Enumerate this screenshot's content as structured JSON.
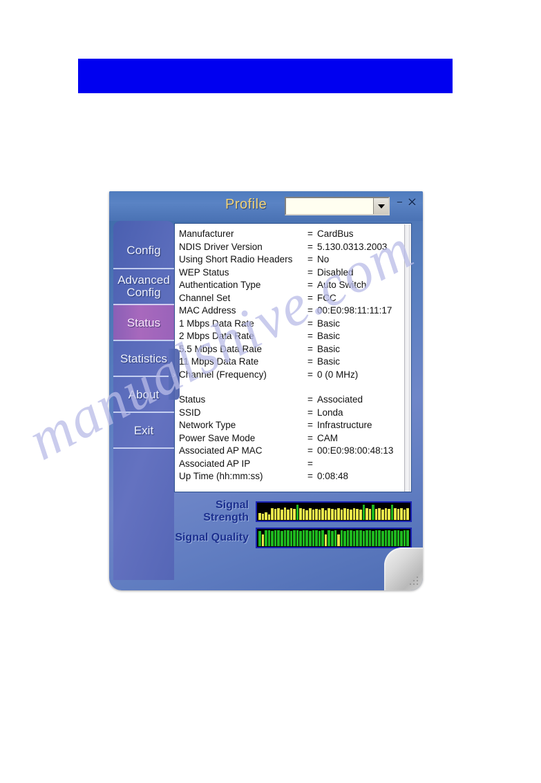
{
  "page": {
    "watermark_text": "manualshive.com",
    "banner_color": "#0000f0"
  },
  "window": {
    "titlebar": {
      "profile_label": "Profile",
      "profile_value": "",
      "profile_placeholder": "",
      "minimize_glyph": "–",
      "close_glyph": "×",
      "dropdown_arrow_icon": "chevron-down-icon"
    },
    "sidebar": {
      "collapse_glyph": "›",
      "items": [
        {
          "label": "Config",
          "active": false
        },
        {
          "label": "Advanced Config",
          "active": false
        },
        {
          "label": "Status",
          "active": true
        },
        {
          "label": "Statistics",
          "active": false
        },
        {
          "label": "About",
          "active": false
        },
        {
          "label": "Exit",
          "active": false
        }
      ]
    },
    "status_panel": {
      "rows": [
        {
          "key": "Manufacturer",
          "eq": "=",
          "value": "CardBus"
        },
        {
          "key": "NDIS Driver Version",
          "eq": "=",
          "value": "5.130.0313.2003"
        },
        {
          "key": "Using Short Radio Headers",
          "eq": "=",
          "value": "No"
        },
        {
          "key": "WEP Status",
          "eq": "=",
          "value": "Disabled"
        },
        {
          "key": "Authentication Type",
          "eq": "=",
          "value": "Auto Switch"
        },
        {
          "key": "Channel Set",
          "eq": "=",
          "value": "FCC"
        },
        {
          "key": "MAC Address",
          "eq": "=",
          "value": "00:E0:98:11:11:17"
        },
        {
          "key": "1 Mbps Data Rate",
          "eq": "=",
          "value": "Basic"
        },
        {
          "key": "2 Mbps Data Rate",
          "eq": "=",
          "value": "Basic"
        },
        {
          "key": "5.5 Mbps Data Rate",
          "eq": "=",
          "value": "Basic"
        },
        {
          "key": "11 Mbps Data Rate",
          "eq": "=",
          "value": "Basic"
        },
        {
          "key": "Channel (Frequency)",
          "eq": "=",
          "value": "0 (0 MHz)"
        },
        {
          "key": "",
          "eq": "",
          "value": ""
        },
        {
          "key": "Status",
          "eq": "=",
          "value": "Associated"
        },
        {
          "key": "SSID",
          "eq": "=",
          "value": "Londa"
        },
        {
          "key": "Network Type",
          "eq": "=",
          "value": "Infrastructure"
        },
        {
          "key": "Power Save Mode",
          "eq": "=",
          "value": "CAM"
        },
        {
          "key": "Associated AP MAC",
          "eq": "=",
          "value": "00:E0:98:00:48:13"
        },
        {
          "key": "Associated AP IP",
          "eq": "=",
          "value": ""
        },
        {
          "key": "Up Time (hh:mm:ss)",
          "eq": "=",
          "value": "0:08:48"
        }
      ]
    },
    "signal": {
      "strength": {
        "label": "Signal Strength",
        "bar_color_low": "#e9e84b",
        "bar_color_high": "#1fb81f",
        "levels": [
          42,
          38,
          46,
          34,
          70,
          66,
          72,
          64,
          74,
          62,
          70,
          66,
          92,
          72,
          66,
          58,
          70,
          62,
          68,
          64,
          72,
          60,
          70,
          66,
          62,
          70,
          64,
          72,
          66,
          62,
          70,
          68,
          64,
          90,
          72,
          68,
          92,
          66,
          70,
          64,
          72,
          66,
          92,
          70,
          66,
          72,
          64,
          70
        ]
      },
      "quality": {
        "label": "Signal Quality",
        "bar_color_low": "#e9e84b",
        "bar_color_high": "#1fb81f",
        "levels": [
          92,
          72,
          96,
          94,
          92,
          96,
          94,
          92,
          96,
          94,
          92,
          96,
          94,
          92,
          96,
          94,
          92,
          96,
          94,
          92,
          96,
          70,
          94,
          92,
          96,
          72,
          94,
          92,
          96,
          94,
          92,
          96,
          94,
          92,
          96,
          94,
          92,
          96,
          94,
          92,
          96,
          94,
          92,
          96,
          94,
          92,
          96,
          94
        ]
      }
    }
  }
}
